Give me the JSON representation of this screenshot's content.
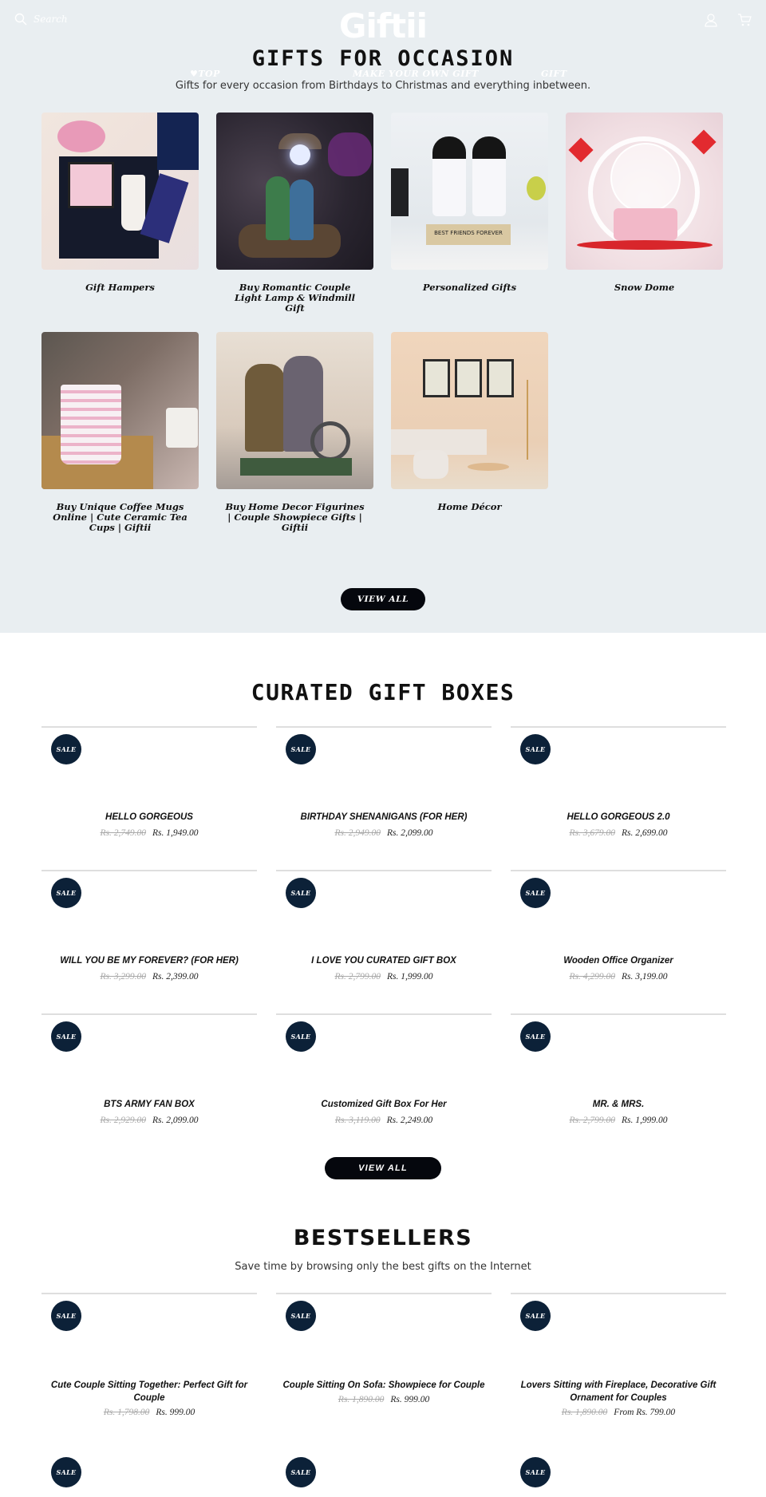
{
  "header": {
    "search_placeholder": "Search",
    "logo": "Giftii",
    "icons": {
      "search": "search-icon",
      "account": "user-icon",
      "cart": "cart-icon"
    },
    "nav": [
      "♥TOP",
      "MAKE YOUR OWN GIFT",
      "GIFT"
    ]
  },
  "occasion": {
    "title": "GIFTS FOR OCCASION",
    "subtitle": "Gifts for every occasion from Birthdays to Christmas and everything inbetween.",
    "items": [
      {
        "label": "Gift Hampers"
      },
      {
        "label": "Buy Romantic Couple Light Lamp & Windmill Gift"
      },
      {
        "label": "Personalized Gifts",
        "image_text": "BEST FRIENDS FOREVER"
      },
      {
        "label": "Snow Dome"
      },
      {
        "label": "Buy Unique Coffee Mugs Online | Cute Ceramic Tea Cups | Giftii"
      },
      {
        "label": "Buy Home Decor Figurines | Couple Showpiece Gifts | Giftii"
      },
      {
        "label": "Home Décor"
      }
    ],
    "view_all": "VIEW ALL"
  },
  "curated": {
    "title": "CURATED GIFT BOXES",
    "badge": "SALE",
    "products": [
      {
        "name": "HELLO GORGEOUS",
        "was": "Rs. 2,749.00",
        "price": "Rs. 1,949.00"
      },
      {
        "name": "BIRTHDAY SHENANIGANS (FOR HER)",
        "was": "Rs. 2,949.00",
        "price": "Rs. 2,099.00"
      },
      {
        "name": "HELLO GORGEOUS 2.0",
        "was": "Rs. 3,679.00",
        "price": "Rs. 2,699.00"
      },
      {
        "name": "WILL YOU BE MY FOREVER? (FOR HER)",
        "was": "Rs. 3,299.00",
        "price": "Rs. 2,399.00"
      },
      {
        "name": "I LOVE YOU CURATED GIFT BOX",
        "was": "Rs. 2,799.00",
        "price": "Rs. 1,999.00"
      },
      {
        "name": "Wooden Office Organizer",
        "was": "Rs. 4,299.00",
        "price": "Rs. 3,199.00"
      },
      {
        "name": "BTS ARMY FAN BOX",
        "was": "Rs. 2,929.00",
        "price": "Rs. 2,099.00"
      },
      {
        "name": "Customized Gift Box For Her",
        "was": "Rs. 3,119.00",
        "price": "Rs. 2,249.00"
      },
      {
        "name": "MR. & MRS.",
        "was": "Rs. 2,799.00",
        "price": "Rs. 1,999.00"
      }
    ],
    "view_all": "VIEW ALL"
  },
  "bestsellers": {
    "title": "BESTSELLERS",
    "subtitle": "Save time by browsing only the best gifts on the Internet",
    "badge": "SALE",
    "products": [
      {
        "name": "Cute Couple Sitting Together: Perfect Gift for Couple",
        "was": "Rs. 1,798.00",
        "price": "Rs. 999.00"
      },
      {
        "name": "Couple Sitting On Sofa: Showpiece for Couple",
        "was": "Rs. 1,890.00",
        "price": "Rs. 999.00"
      },
      {
        "name": "Lovers Sitting with Fireplace, Decorative Gift Ornament for Couples",
        "was": "Rs. 1,890.00",
        "price": "From Rs. 799.00"
      }
    ]
  },
  "colors": {
    "occasion_bg": "#e9eef1",
    "button_bg": "#05070d",
    "sale_badge_bg": "#0c2138",
    "strike_price": "#a9a9a9"
  }
}
